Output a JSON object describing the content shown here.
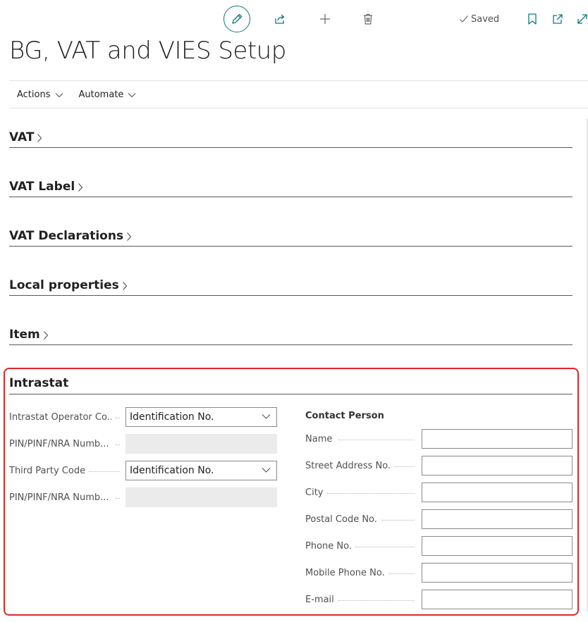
{
  "header": {
    "title": "BG, VAT and VIES Setup",
    "saved_label": "Saved",
    "icons": [
      "edit-icon",
      "share-icon",
      "plus-icon",
      "delete-icon",
      "check-icon",
      "bookmark-icon",
      "open-new-window-icon",
      "expand-icon"
    ],
    "accent_color": "#0b7a7e"
  },
  "action_bar": {
    "actions_label": "Actions",
    "automate_label": "Automate"
  },
  "sections": {
    "vat": "VAT",
    "vat_label": "VAT Label",
    "vat_declarations": "VAT Declarations",
    "local_properties": "Local properties",
    "item": "Item"
  },
  "intrastat": {
    "title": "Intrastat",
    "highlight_color": "#e0262a",
    "fields": {
      "operator_code_label": "Intrastat Operator Co...",
      "operator_code_value": "Identification No.",
      "pin1_label": "PIN/PINF/NRA Numb...",
      "third_party_label": "Third Party Code",
      "third_party_value": "Identification No.",
      "pin2_label": "PIN/PINF/NRA Numb..."
    },
    "contact_person": {
      "title": "Contact Person",
      "name_label": "Name",
      "name_value": "",
      "street_label": "Street Address No.",
      "street_value": "",
      "city_label": "City",
      "city_value": "",
      "postal_label": "Postal Code No.",
      "postal_value": "",
      "phone_label": "Phone No.",
      "phone_value": "",
      "mobile_label": "Mobile Phone No.",
      "mobile_value": "",
      "email_label": "E-mail",
      "email_value": ""
    }
  }
}
